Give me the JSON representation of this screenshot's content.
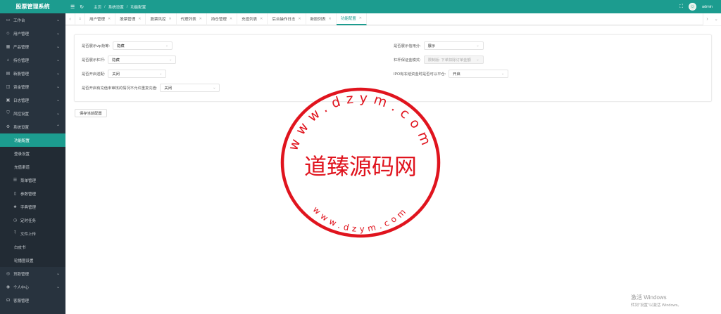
{
  "app": {
    "title": "股票管理系统"
  },
  "header": {
    "crumbs": [
      "主页",
      "系统设置",
      "功能配置"
    ],
    "user": "admin"
  },
  "sidebar": {
    "items": [
      {
        "label": "工作台",
        "icon": "monitor-icon"
      },
      {
        "label": "用户管理",
        "icon": "user-icon"
      },
      {
        "label": "产品管理",
        "icon": "grid-icon"
      },
      {
        "label": "持仓管理",
        "icon": "home-icon"
      },
      {
        "label": "新股管理",
        "icon": "newspaper-icon"
      },
      {
        "label": "资金管理",
        "icon": "wallet-icon"
      },
      {
        "label": "日志管理",
        "icon": "calendar-icon"
      },
      {
        "label": "风控设置",
        "icon": "shield-icon"
      },
      {
        "label": "系统设置",
        "icon": "gear-icon"
      }
    ],
    "subitems": [
      {
        "label": "功能配置",
        "active": true
      },
      {
        "label": "登录设置"
      },
      {
        "label": "充值渠道"
      },
      {
        "label": "菜单管理",
        "icon": "list-icon"
      },
      {
        "label": "参数管理",
        "icon": "doc-icon"
      },
      {
        "label": "字典管理",
        "icon": "tree-icon"
      },
      {
        "label": "定时任务",
        "icon": "clock-icon"
      },
      {
        "label": "文件上传",
        "icon": "upload-icon"
      },
      {
        "label": "白皮书"
      },
      {
        "label": "轮播图设置"
      }
    ],
    "bottom": [
      {
        "label": "贷款管理",
        "icon": "coin-icon"
      },
      {
        "label": "个人中心",
        "icon": "person-icon"
      },
      {
        "label": "客服管理",
        "icon": "headset-icon"
      }
    ]
  },
  "tabs": [
    {
      "label": "用户管理"
    },
    {
      "label": "股票管理"
    },
    {
      "label": "股票风控"
    },
    {
      "label": "代理列表"
    },
    {
      "label": "持仓管理"
    },
    {
      "label": "充值列表"
    },
    {
      "label": "后台操作日志"
    },
    {
      "label": "新股列表"
    },
    {
      "label": "功能配置",
      "active": true
    }
  ],
  "form": {
    "vip_label": "是否展示vip抢筹:",
    "vip_value": "隐藏",
    "credit_label": "是否展示信用分:",
    "credit_value": "展示",
    "leverage_label": "是否展示杠杆:",
    "leverage_value": "隐藏",
    "margin_label": "杠杆保证金模式:",
    "margin_value": "限制版: 下单扣除订单金额",
    "allot_label": "是否开启送配:",
    "allot_value": "关闭",
    "ipo_label": "IPO有冻结资金时是否可以平仓:",
    "ipo_value": "开启",
    "recharge_label": "是否开启有充值未审核的情况不允许重复充值:",
    "recharge_value": "关闭",
    "save_label": "保存当前配置"
  },
  "watermark": {
    "top_arc": "www.dzym.com",
    "center": "道臻源码网",
    "bottom_arc": "www.dzym.com"
  },
  "windows": {
    "line1": "激活 Windows",
    "line2": "转到\"设置\"以激活 Windows。"
  },
  "colors": {
    "primary": "#1c9c8f",
    "sidebar": "#28333e",
    "stamp": "#e0141e"
  }
}
